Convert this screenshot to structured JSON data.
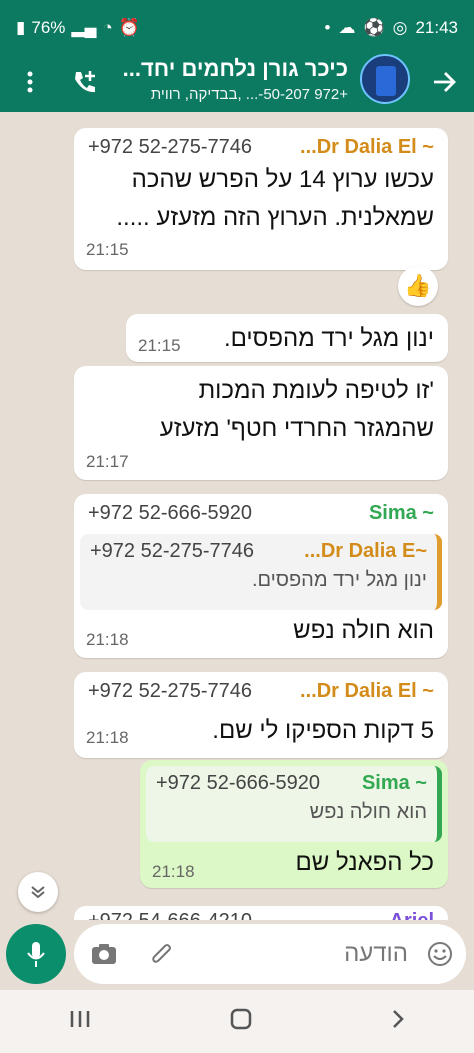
{
  "status_bar": {
    "battery": "76%",
    "time": "21:43"
  },
  "header": {
    "title": "כיכר גורן נלחמים יחד...",
    "subtitle": "+972 50-207-... ,בבדיקה, רווית"
  },
  "messages": [
    {
      "sender_name": "~ Dr Dalia El...",
      "sender_phone": "+972 52-275-7746",
      "text_lines": [
        "עכשו ערוץ 14 על הפרש שהכה",
        "שמאלנית. הערוץ הזה מזעזע ....."
      ],
      "time": "21:15",
      "reaction": "👍"
    },
    {
      "text_lines": [
        "ינון מגל ירד מהפסים."
      ],
      "time": "21:15"
    },
    {
      "text_lines": [
        "'זו לטיפה לעומת המכות",
        "שהמגזר החרדי חטף' מזעזע"
      ],
      "time": "21:17"
    },
    {
      "sender_name": "~ Sima",
      "sender_phone": "+972 52-666-5920",
      "quote": {
        "sender_name": "~Dr Dalia E...",
        "sender_phone": "+972 52-275-7746",
        "text": "ינון מגל ירד מהפסים."
      },
      "text_lines": [
        "הוא חולה נפש"
      ],
      "time": "21:18"
    },
    {
      "sender_name": "~ Dr Dalia El...",
      "sender_phone": "+972 52-275-7746",
      "text_lines": [
        "5 דקות הספיקו לי שם."
      ],
      "time": "21:18"
    },
    {
      "outgoing": true,
      "quote": {
        "sender_name": "~ Sima",
        "sender_phone": "+972 52-666-5920",
        "text": "הוא חולה נפש"
      },
      "text_lines": [
        "כל הפאנל שם"
      ],
      "time": "21:18"
    },
    {
      "sender_name": "Ariel",
      "sender_phone": "+972 54-666-4210",
      "partial": true
    }
  ],
  "input": {
    "placeholder": "הודעה"
  },
  "colors": {
    "header_bg": "#0b7a60",
    "outgoing_bubble": "#dcf8c6",
    "sender_orange": "#d38c1a",
    "sender_green": "#33a852",
    "mic_green": "#0b8e6b"
  }
}
